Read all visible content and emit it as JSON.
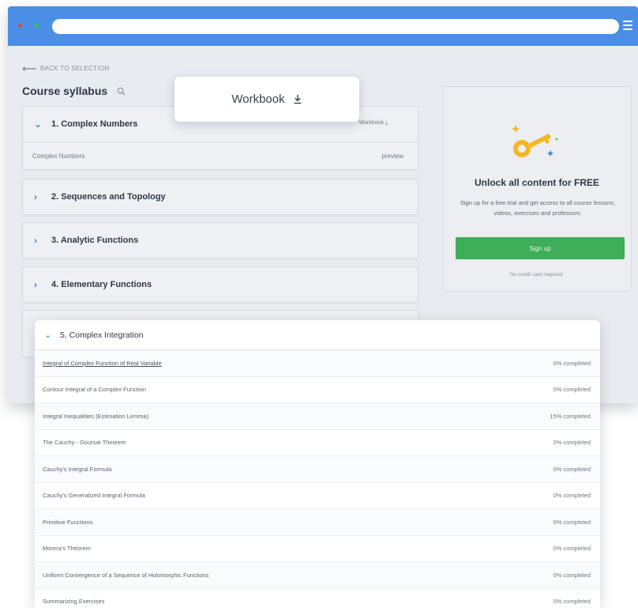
{
  "back_link": "BACK TO SELECTION",
  "syllabus_title": "Course syllabus",
  "workbook_card_label": "Workbook",
  "chapters": [
    {
      "label": "1. Complex Numbers",
      "workbook": "Workbook",
      "lessons": [
        {
          "title": "Complex Numbers",
          "status": "preview"
        }
      ]
    },
    {
      "label": "2. Sequences and Topology"
    },
    {
      "label": "3. Analytic Functions"
    },
    {
      "label": "4. Elementary Functions"
    }
  ],
  "promo": {
    "title": "Unlock all content for FREE",
    "description": "Sign up for a free trial and get access to all course lessons, videos, exercises and professors.",
    "button": "Sign up",
    "note": "No credit card required."
  },
  "chapter5": {
    "label": "5. Complex Integration",
    "lessons": [
      {
        "title": "Integral of Complex Function of Real Variable",
        "status": "0% completed"
      },
      {
        "title": "Contour Integral of a Complex Function",
        "status": "0% completed"
      },
      {
        "title": "Integral Inequalities (Estimation Lemma)",
        "status": "15% completed"
      },
      {
        "title": "The Cauchy - Goursat Theorem",
        "status": "0% completed"
      },
      {
        "title": "Cauchy's Integral Formula",
        "status": "0% completed"
      },
      {
        "title": "Cauchy's Generalized Integral Formula",
        "status": "0% completed"
      },
      {
        "title": "Primitive Functions",
        "status": "0% completed"
      },
      {
        "title": "Morera's Theorem",
        "status": "0% completed"
      },
      {
        "title": "Uniform Convergence of a Sequence of Holomorphic Functions",
        "status": "0% completed"
      },
      {
        "title": "Summarizing Exercises",
        "status": "0% completed"
      }
    ]
  },
  "colors": {
    "browser_bar": "#4a8ee5",
    "accent_blue": "#3b82c4",
    "signup_green": "#3fae58",
    "key_yellow": "#f2b824"
  }
}
